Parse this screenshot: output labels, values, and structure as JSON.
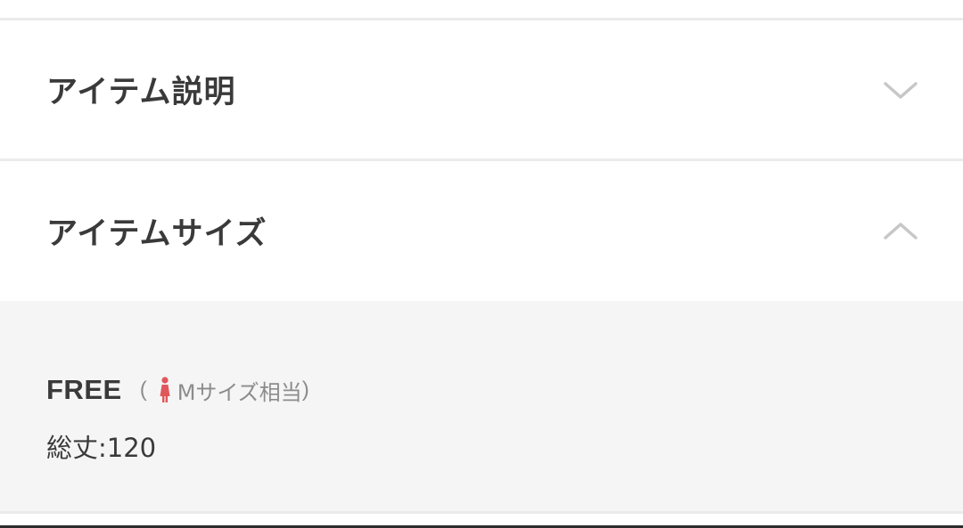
{
  "accordion": {
    "description": {
      "title": "アイテム説明",
      "state": "collapsed",
      "icon": "chevron-down-icon"
    },
    "size": {
      "title": "アイテムサイズ",
      "state": "expanded",
      "icon": "chevron-up-icon"
    }
  },
  "size_panel": {
    "size_name": "FREE",
    "note_open": "(",
    "note_icon": "female-figure-icon",
    "note_text": "Mサイズ相当",
    "note_close": ")",
    "measurement": "総丈:120"
  },
  "colors": {
    "title_text": "#3a3a3a",
    "chevron": "#c7c7c7",
    "panel_bg": "#f5f5f5",
    "divider": "#ebebeb",
    "note_text": "#8c8c8c",
    "figure_icon": "#e0575b"
  }
}
